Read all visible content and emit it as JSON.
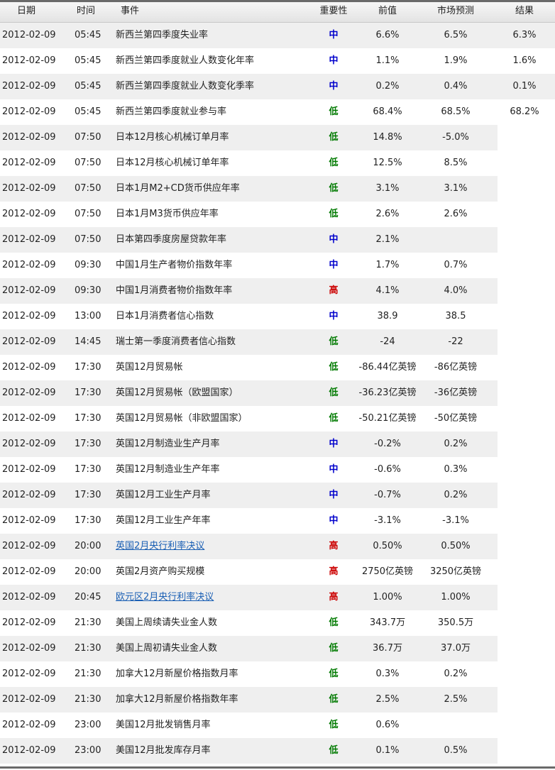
{
  "colors": {
    "importance_mid": "#0000cc",
    "importance_low": "#007a00",
    "importance_high": "#cc0000",
    "link": "#1a5fb4",
    "row_stripe": "#efefef"
  },
  "header": {
    "date": "日期",
    "time": "时间",
    "event": "事件",
    "importance": "重要性",
    "previous": "前值",
    "forecast": "市场预测",
    "result": "结果"
  },
  "rows": [
    {
      "date": "2012-02-09",
      "time": "05:45",
      "event": "新西兰第四季度失业率",
      "importance": "中",
      "previous": "6.6%",
      "forecast": "6.5%",
      "result": "6.3%",
      "link": false
    },
    {
      "date": "2012-02-09",
      "time": "05:45",
      "event": "新西兰第四季度就业人数变化年率",
      "importance": "中",
      "previous": "1.1%",
      "forecast": "1.9%",
      "result": "1.6%",
      "link": false
    },
    {
      "date": "2012-02-09",
      "time": "05:45",
      "event": "新西兰第四季度就业人数变化季率",
      "importance": "中",
      "previous": "0.2%",
      "forecast": "0.4%",
      "result": "0.1%",
      "link": false
    },
    {
      "date": "2012-02-09",
      "time": "05:45",
      "event": "新西兰第四季度就业参与率",
      "importance": "低",
      "previous": "68.4%",
      "forecast": "68.5%",
      "result": "68.2%",
      "link": false
    },
    {
      "date": "2012-02-09",
      "time": "07:50",
      "event": "日本12月核心机械订单月率",
      "importance": "低",
      "previous": "14.8%",
      "forecast": "-5.0%",
      "result": "",
      "link": false
    },
    {
      "date": "2012-02-09",
      "time": "07:50",
      "event": "日本12月核心机械订单年率",
      "importance": "低",
      "previous": "12.5%",
      "forecast": "8.5%",
      "result": "",
      "link": false
    },
    {
      "date": "2012-02-09",
      "time": "07:50",
      "event": "日本1月M2+CD货币供应年率",
      "importance": "低",
      "previous": "3.1%",
      "forecast": "3.1%",
      "result": "",
      "link": false
    },
    {
      "date": "2012-02-09",
      "time": "07:50",
      "event": "日本1月M3货币供应年率",
      "importance": "低",
      "previous": "2.6%",
      "forecast": "2.6%",
      "result": "",
      "link": false
    },
    {
      "date": "2012-02-09",
      "time": "07:50",
      "event": "日本第四季度房屋贷款年率",
      "importance": "中",
      "previous": "2.1%",
      "forecast": "",
      "result": "",
      "link": false
    },
    {
      "date": "2012-02-09",
      "time": "09:30",
      "event": "中国1月生产者物价指数年率",
      "importance": "中",
      "previous": "1.7%",
      "forecast": "0.7%",
      "result": "",
      "link": false
    },
    {
      "date": "2012-02-09",
      "time": "09:30",
      "event": "中国1月消费者物价指数年率",
      "importance": "高",
      "previous": "4.1%",
      "forecast": "4.0%",
      "result": "",
      "link": false
    },
    {
      "date": "2012-02-09",
      "time": "13:00",
      "event": "日本1月消费者信心指数",
      "importance": "中",
      "previous": "38.9",
      "forecast": "38.5",
      "result": "",
      "link": false
    },
    {
      "date": "2012-02-09",
      "time": "14:45",
      "event": "瑞士第一季度消费者信心指数",
      "importance": "低",
      "previous": "-24",
      "forecast": "-22",
      "result": "",
      "link": false
    },
    {
      "date": "2012-02-09",
      "time": "17:30",
      "event": "英国12月贸易帐",
      "importance": "低",
      "previous": "-86.44亿英镑",
      "forecast": "-86亿英镑",
      "result": "",
      "link": false
    },
    {
      "date": "2012-02-09",
      "time": "17:30",
      "event": "英国12月贸易帐（欧盟国家）",
      "importance": "低",
      "previous": "-36.23亿英镑",
      "forecast": "-36亿英镑",
      "result": "",
      "link": false
    },
    {
      "date": "2012-02-09",
      "time": "17:30",
      "event": "英国12月贸易帐（非欧盟国家）",
      "importance": "低",
      "previous": "-50.21亿英镑",
      "forecast": "-50亿英镑",
      "result": "",
      "link": false
    },
    {
      "date": "2012-02-09",
      "time": "17:30",
      "event": "英国12月制造业生产月率",
      "importance": "中",
      "previous": "-0.2%",
      "forecast": "0.2%",
      "result": "",
      "link": false
    },
    {
      "date": "2012-02-09",
      "time": "17:30",
      "event": "英国12月制造业生产年率",
      "importance": "中",
      "previous": "-0.6%",
      "forecast": "0.3%",
      "result": "",
      "link": false
    },
    {
      "date": "2012-02-09",
      "time": "17:30",
      "event": "英国12月工业生产月率",
      "importance": "中",
      "previous": "-0.7%",
      "forecast": "0.2%",
      "result": "",
      "link": false
    },
    {
      "date": "2012-02-09",
      "time": "17:30",
      "event": "英国12月工业生产年率",
      "importance": "中",
      "previous": "-3.1%",
      "forecast": "-3.1%",
      "result": "",
      "link": false
    },
    {
      "date": "2012-02-09",
      "time": "20:00",
      "event": "英国2月央行利率决议",
      "importance": "高",
      "previous": "0.50%",
      "forecast": "0.50%",
      "result": "",
      "link": true
    },
    {
      "date": "2012-02-09",
      "time": "20:00",
      "event": "英国2月资产购买规模",
      "importance": "高",
      "previous": "2750亿英镑",
      "forecast": "3250亿英镑",
      "result": "",
      "link": false
    },
    {
      "date": "2012-02-09",
      "time": "20:45",
      "event": "欧元区2月央行利率决议",
      "importance": "高",
      "previous": "1.00%",
      "forecast": "1.00%",
      "result": "",
      "link": true
    },
    {
      "date": "2012-02-09",
      "time": "21:30",
      "event": "美国上周续请失业金人数",
      "importance": "低",
      "previous": "343.7万",
      "forecast": "350.5万",
      "result": "",
      "link": false
    },
    {
      "date": "2012-02-09",
      "time": "21:30",
      "event": "美国上周初请失业金人数",
      "importance": "低",
      "previous": "36.7万",
      "forecast": "37.0万",
      "result": "",
      "link": false
    },
    {
      "date": "2012-02-09",
      "time": "21:30",
      "event": "加拿大12月新屋价格指数月率",
      "importance": "低",
      "previous": "0.3%",
      "forecast": "0.2%",
      "result": "",
      "link": false
    },
    {
      "date": "2012-02-09",
      "time": "21:30",
      "event": "加拿大12月新屋价格指数年率",
      "importance": "低",
      "previous": "2.5%",
      "forecast": "2.5%",
      "result": "",
      "link": false
    },
    {
      "date": "2012-02-09",
      "time": "23:00",
      "event": "美国12月批发销售月率",
      "importance": "低",
      "previous": "0.6%",
      "forecast": "",
      "result": "",
      "link": false
    },
    {
      "date": "2012-02-09",
      "time": "23:00",
      "event": "美国12月批发库存月率",
      "importance": "低",
      "previous": "0.1%",
      "forecast": "0.5%",
      "result": "",
      "link": false
    }
  ]
}
